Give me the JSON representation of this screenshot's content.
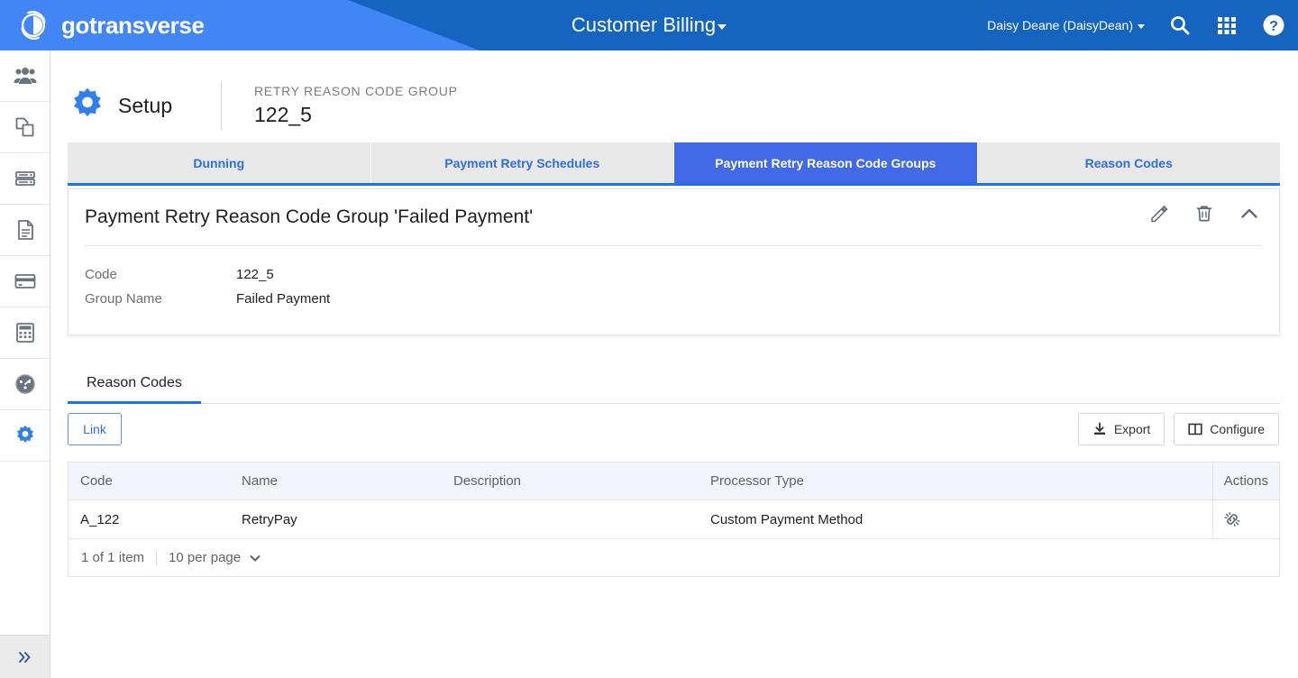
{
  "header": {
    "logo_text": "gotransverse",
    "logo_icon": "gotransverse-circle-logo",
    "app_title": "Customer Billing",
    "user_name": "Daisy Deane (DaisyDean)",
    "icons": [
      "search-icon",
      "apps-grid-icon",
      "help-circle-icon"
    ],
    "colors": {
      "light_blue": "#4285f4",
      "dark_blue": "#1565c0"
    }
  },
  "sidebar": {
    "items": [
      {
        "name": "customers-icon",
        "label": "Customers"
      },
      {
        "name": "products-icon",
        "label": "Products"
      },
      {
        "name": "accounts-icon",
        "label": "Accounts"
      },
      {
        "name": "invoices-icon",
        "label": "Invoices"
      },
      {
        "name": "payments-icon",
        "label": "Payments"
      },
      {
        "name": "billing-icon",
        "label": "Billing"
      },
      {
        "name": "reports-icon",
        "label": "Reports"
      },
      {
        "name": "setup-icon",
        "label": "Setup"
      }
    ],
    "expand_icon": "double-chevron-right-icon"
  },
  "page_head": {
    "section_icon": "gear-icon",
    "section_label": "Setup",
    "record_type": "RETRY REASON CODE GROUP",
    "record_id": "122_5"
  },
  "tabs": [
    {
      "label": "Dunning",
      "active": false
    },
    {
      "label": "Payment Retry Schedules",
      "active": false
    },
    {
      "label": "Payment Retry Reason Code Groups",
      "active": true
    },
    {
      "label": "Reason Codes",
      "active": false
    }
  ],
  "card": {
    "title": "Payment Retry Reason Code Group 'Failed Payment'",
    "actions": [
      {
        "name": "edit-pencil-icon",
        "label": "Edit"
      },
      {
        "name": "delete-trash-icon",
        "label": "Delete"
      },
      {
        "name": "collapse-chevron-up-icon",
        "label": "Collapse"
      }
    ],
    "fields": [
      {
        "label": "Code",
        "value": "122_5"
      },
      {
        "label": "Group Name",
        "value": "Failed Payment"
      }
    ]
  },
  "subtabs": [
    {
      "label": "Reason Codes",
      "active": true
    }
  ],
  "toolbar": {
    "link_label": "Link",
    "export_label": "Export",
    "export_icon": "download-icon",
    "configure_label": "Configure",
    "configure_icon": "columns-icon"
  },
  "table": {
    "columns": [
      "Code",
      "Name",
      "Description",
      "Processor Type",
      "Actions"
    ],
    "rows": [
      {
        "code": "A_122",
        "name": "RetryPay",
        "description": "",
        "processor_type": "Custom Payment Method",
        "action_icon": "unlink-icon"
      }
    ],
    "footer": {
      "count_text": "1 of 1 item",
      "per_page_text": "10 per page",
      "per_page_icon": "chevron-down-icon"
    }
  },
  "colors": {
    "accent_blue": "#1a73e8",
    "tab_active": "#4169e8",
    "link_blue": "#2f6fe0",
    "header_dark": "#1565c0"
  }
}
